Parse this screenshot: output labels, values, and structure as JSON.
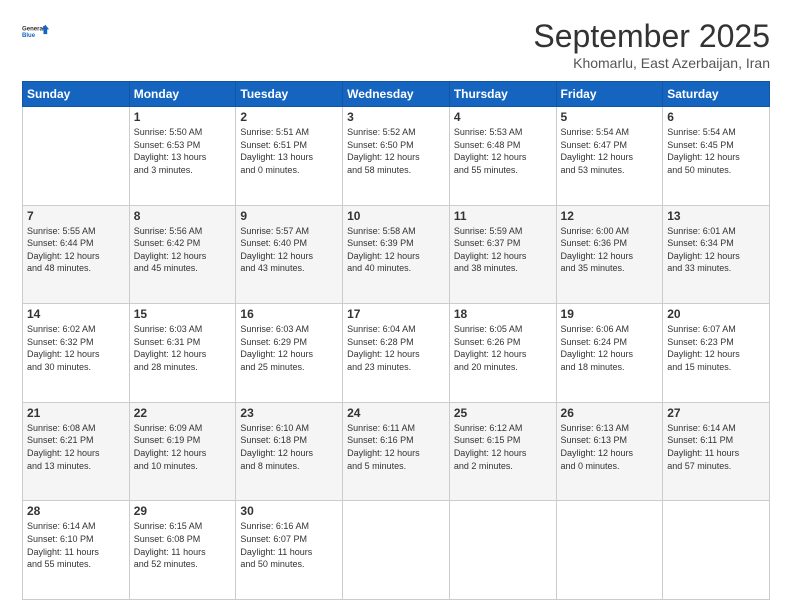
{
  "header": {
    "logo_line1": "General",
    "logo_line2": "Blue",
    "month": "September 2025",
    "location": "Khomarlu, East Azerbaijan, Iran"
  },
  "weekdays": [
    "Sunday",
    "Monday",
    "Tuesday",
    "Wednesday",
    "Thursday",
    "Friday",
    "Saturday"
  ],
  "weeks": [
    [
      {
        "day": "",
        "detail": ""
      },
      {
        "day": "1",
        "detail": "Sunrise: 5:50 AM\nSunset: 6:53 PM\nDaylight: 13 hours\nand 3 minutes."
      },
      {
        "day": "2",
        "detail": "Sunrise: 5:51 AM\nSunset: 6:51 PM\nDaylight: 13 hours\nand 0 minutes."
      },
      {
        "day": "3",
        "detail": "Sunrise: 5:52 AM\nSunset: 6:50 PM\nDaylight: 12 hours\nand 58 minutes."
      },
      {
        "day": "4",
        "detail": "Sunrise: 5:53 AM\nSunset: 6:48 PM\nDaylight: 12 hours\nand 55 minutes."
      },
      {
        "day": "5",
        "detail": "Sunrise: 5:54 AM\nSunset: 6:47 PM\nDaylight: 12 hours\nand 53 minutes."
      },
      {
        "day": "6",
        "detail": "Sunrise: 5:54 AM\nSunset: 6:45 PM\nDaylight: 12 hours\nand 50 minutes."
      }
    ],
    [
      {
        "day": "7",
        "detail": "Sunrise: 5:55 AM\nSunset: 6:44 PM\nDaylight: 12 hours\nand 48 minutes."
      },
      {
        "day": "8",
        "detail": "Sunrise: 5:56 AM\nSunset: 6:42 PM\nDaylight: 12 hours\nand 45 minutes."
      },
      {
        "day": "9",
        "detail": "Sunrise: 5:57 AM\nSunset: 6:40 PM\nDaylight: 12 hours\nand 43 minutes."
      },
      {
        "day": "10",
        "detail": "Sunrise: 5:58 AM\nSunset: 6:39 PM\nDaylight: 12 hours\nand 40 minutes."
      },
      {
        "day": "11",
        "detail": "Sunrise: 5:59 AM\nSunset: 6:37 PM\nDaylight: 12 hours\nand 38 minutes."
      },
      {
        "day": "12",
        "detail": "Sunrise: 6:00 AM\nSunset: 6:36 PM\nDaylight: 12 hours\nand 35 minutes."
      },
      {
        "day": "13",
        "detail": "Sunrise: 6:01 AM\nSunset: 6:34 PM\nDaylight: 12 hours\nand 33 minutes."
      }
    ],
    [
      {
        "day": "14",
        "detail": "Sunrise: 6:02 AM\nSunset: 6:32 PM\nDaylight: 12 hours\nand 30 minutes."
      },
      {
        "day": "15",
        "detail": "Sunrise: 6:03 AM\nSunset: 6:31 PM\nDaylight: 12 hours\nand 28 minutes."
      },
      {
        "day": "16",
        "detail": "Sunrise: 6:03 AM\nSunset: 6:29 PM\nDaylight: 12 hours\nand 25 minutes."
      },
      {
        "day": "17",
        "detail": "Sunrise: 6:04 AM\nSunset: 6:28 PM\nDaylight: 12 hours\nand 23 minutes."
      },
      {
        "day": "18",
        "detail": "Sunrise: 6:05 AM\nSunset: 6:26 PM\nDaylight: 12 hours\nand 20 minutes."
      },
      {
        "day": "19",
        "detail": "Sunrise: 6:06 AM\nSunset: 6:24 PM\nDaylight: 12 hours\nand 18 minutes."
      },
      {
        "day": "20",
        "detail": "Sunrise: 6:07 AM\nSunset: 6:23 PM\nDaylight: 12 hours\nand 15 minutes."
      }
    ],
    [
      {
        "day": "21",
        "detail": "Sunrise: 6:08 AM\nSunset: 6:21 PM\nDaylight: 12 hours\nand 13 minutes."
      },
      {
        "day": "22",
        "detail": "Sunrise: 6:09 AM\nSunset: 6:19 PM\nDaylight: 12 hours\nand 10 minutes."
      },
      {
        "day": "23",
        "detail": "Sunrise: 6:10 AM\nSunset: 6:18 PM\nDaylight: 12 hours\nand 8 minutes."
      },
      {
        "day": "24",
        "detail": "Sunrise: 6:11 AM\nSunset: 6:16 PM\nDaylight: 12 hours\nand 5 minutes."
      },
      {
        "day": "25",
        "detail": "Sunrise: 6:12 AM\nSunset: 6:15 PM\nDaylight: 12 hours\nand 2 minutes."
      },
      {
        "day": "26",
        "detail": "Sunrise: 6:13 AM\nSunset: 6:13 PM\nDaylight: 12 hours\nand 0 minutes."
      },
      {
        "day": "27",
        "detail": "Sunrise: 6:14 AM\nSunset: 6:11 PM\nDaylight: 11 hours\nand 57 minutes."
      }
    ],
    [
      {
        "day": "28",
        "detail": "Sunrise: 6:14 AM\nSunset: 6:10 PM\nDaylight: 11 hours\nand 55 minutes."
      },
      {
        "day": "29",
        "detail": "Sunrise: 6:15 AM\nSunset: 6:08 PM\nDaylight: 11 hours\nand 52 minutes."
      },
      {
        "day": "30",
        "detail": "Sunrise: 6:16 AM\nSunset: 6:07 PM\nDaylight: 11 hours\nand 50 minutes."
      },
      {
        "day": "",
        "detail": ""
      },
      {
        "day": "",
        "detail": ""
      },
      {
        "day": "",
        "detail": ""
      },
      {
        "day": "",
        "detail": ""
      }
    ]
  ]
}
